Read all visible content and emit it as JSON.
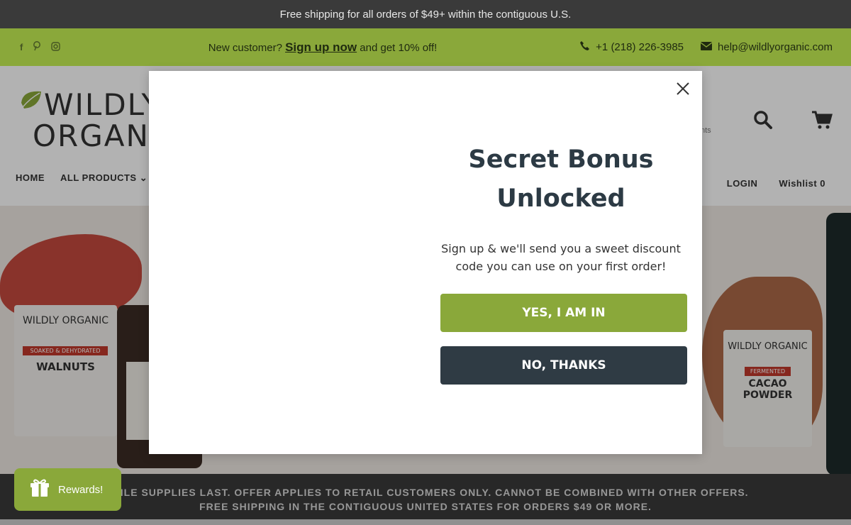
{
  "announcement": "Free shipping for all orders of $49+ within the contiguous U.S.",
  "promo": {
    "prefix": "New customer?",
    "link": "Sign up now",
    "suffix": "and get 10% off!"
  },
  "contact": {
    "phone": "+1 (218) 226-3985",
    "email": "help@wildlyorganic.com"
  },
  "logo": {
    "line1": "WILDLY",
    "line2": "ORGANIC"
  },
  "nav": {
    "home": "HOME",
    "all_products": "ALL PRODUCTS",
    "login": "LOGIN",
    "wishlist": "Wishlist 0"
  },
  "header_fragment": "nts",
  "hero": {
    "bag1_brand": "WILDLY ORGANIC",
    "bag1_tag": "SOAKED & DEHYDRATED",
    "bag1_name": "WALNUTS",
    "bag2_brand": "WILDLY ORGANIC",
    "bag2_tag": "FERMENTED",
    "bag2_name": "CACAO POWDER"
  },
  "strip": {
    "line1": "WHILE SUPPLIES LAST. OFFER APPLIES TO RETAIL CUSTOMERS ONLY. CANNOT BE COMBINED WITH OTHER OFFERS.",
    "line2": "FREE SHIPPING IN THE CONTIGUOUS UNITED STATES FOR ORDERS $49 OR MORE."
  },
  "modal": {
    "title": "Secret Bonus Unlocked",
    "body": "Sign up & we'll send you a sweet discount code you can use on your first order!",
    "yes": "YES, I AM IN",
    "no": "NO, THANKS"
  },
  "rewards": "Rewards!",
  "colors": {
    "brand_green": "#8aa83a",
    "dark": "#2f3b44",
    "announce_bg": "#3a3a3a"
  }
}
